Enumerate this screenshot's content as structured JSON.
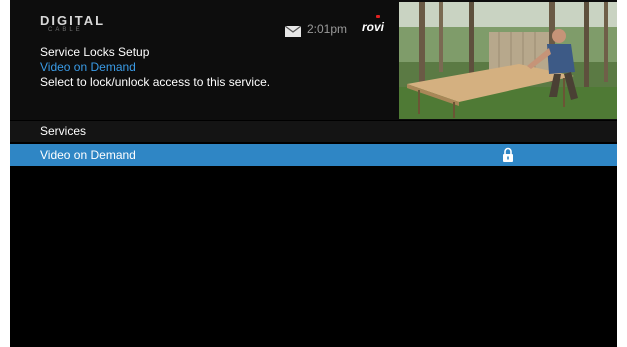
{
  "header": {
    "logo_text": "DIGITAL",
    "logo_sub": "CABLE",
    "mail_icon": "envelope-icon",
    "time": "2:01pm",
    "brand": "rovi",
    "title": "Service Locks Setup",
    "subtitle": "Video on Demand",
    "description": "Select to lock/unlock access to this service."
  },
  "preview": {
    "icon": "video-preview-thumbnail"
  },
  "list": {
    "header": "Services",
    "items": [
      {
        "label": "Video on Demand",
        "locked": true,
        "icon": "lock-icon"
      }
    ]
  },
  "colors": {
    "accent": "#2f86c5",
    "subtitle": "#3a9be6",
    "background": "#000000"
  }
}
